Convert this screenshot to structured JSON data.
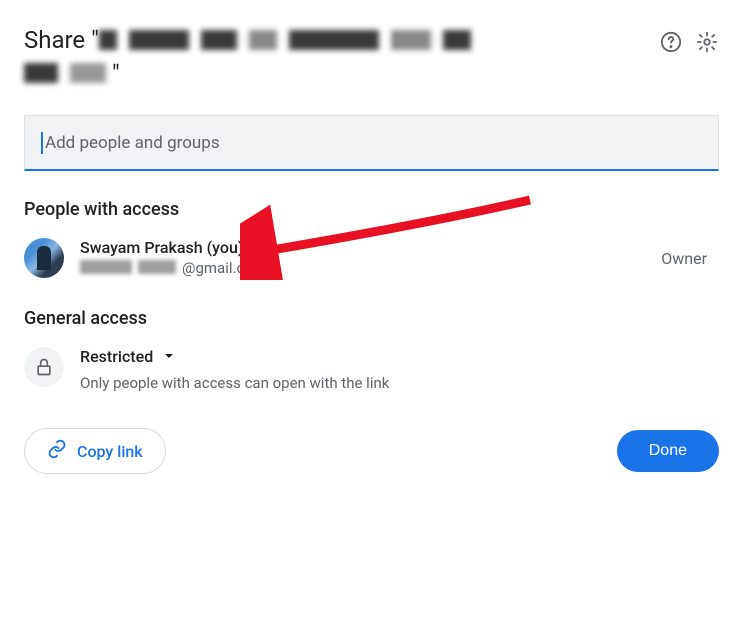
{
  "header": {
    "title_prefix": "Share \"",
    "title_suffix": "\""
  },
  "input": {
    "placeholder": "Add people and groups"
  },
  "sections": {
    "people_access": "People with access",
    "general_access": "General access"
  },
  "person": {
    "name": "Swayam Prakash (you)",
    "email_suffix": "@gmail.com",
    "role": "Owner"
  },
  "general": {
    "level": "Restricted",
    "description": "Only people with access can open with the link"
  },
  "footer": {
    "copy_link": "Copy link",
    "done": "Done"
  }
}
